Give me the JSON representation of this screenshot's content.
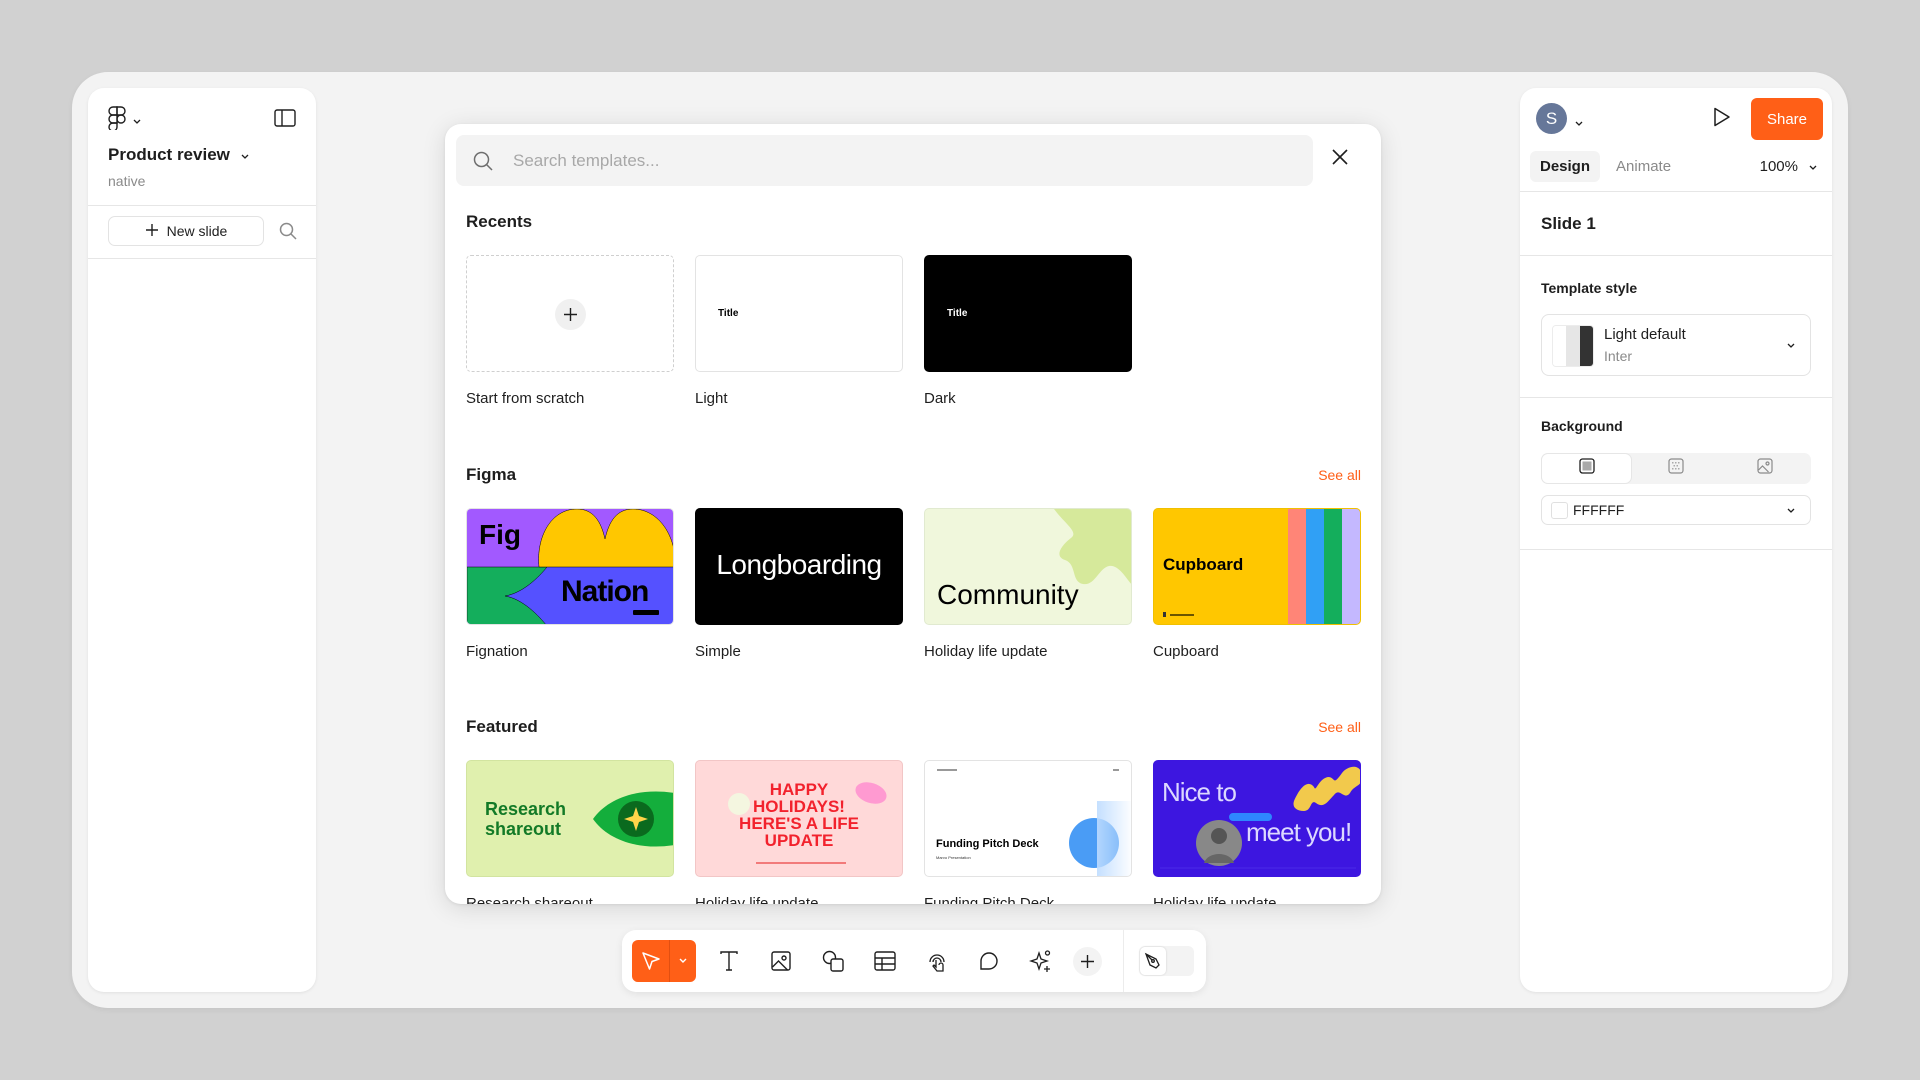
{
  "left_panel": {
    "project_title": "Product review",
    "project_subtitle": "native",
    "new_slide_label": "New slide"
  },
  "right_panel": {
    "avatar_initial": "S",
    "share_label": "Share",
    "tabs": [
      {
        "label": "Design",
        "active": true
      },
      {
        "label": "Animate",
        "active": false
      }
    ],
    "zoom_level": "100%",
    "slide_name": "Slide 1",
    "template_style": {
      "title": "Template style",
      "name": "Light default",
      "font": "Inter",
      "swatch_colors": [
        "#ffffff",
        "#e6e6e6",
        "#333333"
      ]
    },
    "background": {
      "title": "Background",
      "fill_types": [
        "solid-fill",
        "pattern-fill",
        "image-fill"
      ],
      "active_fill": "solid-fill",
      "color_value": "FFFFFF"
    }
  },
  "modal": {
    "search_placeholder": "Search templates...",
    "search_value": "",
    "sections": [
      {
        "title": "Recents",
        "see_all": null,
        "cards": [
          {
            "label": "Start from scratch",
            "thumb_text": ""
          },
          {
            "label": "Light",
            "thumb_text": "Title"
          },
          {
            "label": "Dark",
            "thumb_text": "Title"
          }
        ]
      },
      {
        "title": "Figma",
        "see_all": "See all",
        "cards": [
          {
            "label": "Fignation",
            "thumb_text": [
              "Fig",
              "Nation"
            ]
          },
          {
            "label": "Simple",
            "thumb_text": "Longboarding"
          },
          {
            "label": "Holiday life update",
            "thumb_text": "Community"
          },
          {
            "label": "Cupboard",
            "thumb_text": "Cupboard"
          }
        ]
      },
      {
        "title": "Featured",
        "see_all": "See all",
        "cards": [
          {
            "label": "Research shareout",
            "thumb_text": [
              "Research",
              "shareout"
            ]
          },
          {
            "label": "Holiday life update",
            "thumb_text": [
              "HAPPY",
              "HOLIDAYS!",
              "HERE'S A LIFE",
              "UPDATE"
            ]
          },
          {
            "label": "Funding Pitch Deck",
            "thumb_text": [
              "Funding Pitch Deck",
              "Marvo Presentation"
            ]
          },
          {
            "label": "Holiday life update",
            "thumb_text": [
              "Nice to",
              "meet you!"
            ]
          }
        ]
      }
    ]
  },
  "toolbar": {
    "tools": [
      "move-tool",
      "text-tool",
      "image-tool",
      "shape-tool",
      "table-tool",
      "interaction-tool",
      "comment-tool",
      "ai-tool",
      "add-tool"
    ],
    "active_tool": "move-tool"
  },
  "colors": {
    "accent": "#ff5f17",
    "avatar": "#667799"
  }
}
